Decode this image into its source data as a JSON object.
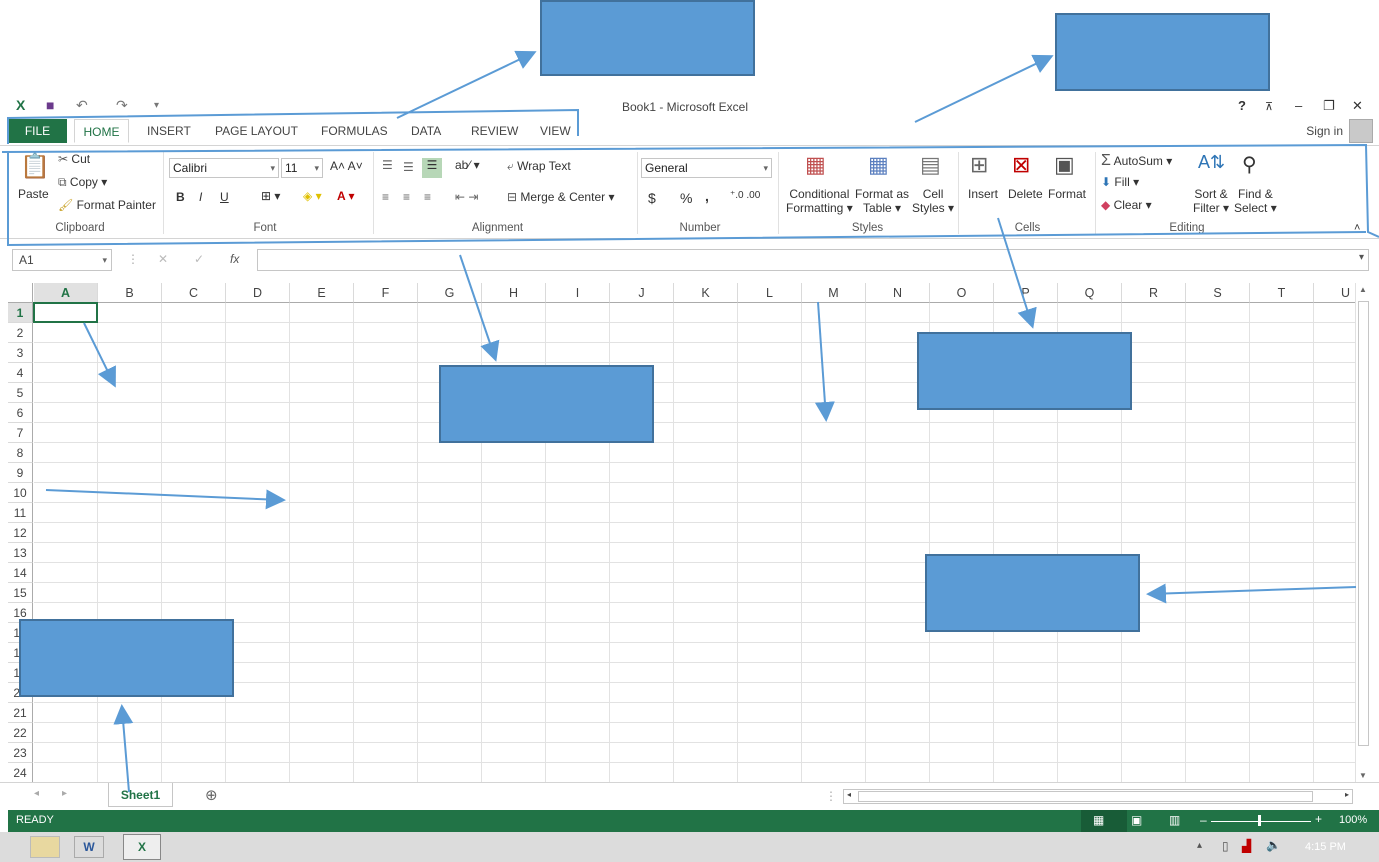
{
  "window": {
    "title": "Book1 - Microsoft Excel",
    "help": "?",
    "sign_in": "Sign in"
  },
  "tabs": [
    {
      "label": "FILE"
    },
    {
      "label": "HOME"
    },
    {
      "label": "INSERT"
    },
    {
      "label": "PAGE LAYOUT"
    },
    {
      "label": "FORMULAS"
    },
    {
      "label": "DATA"
    },
    {
      "label": "REVIEW"
    },
    {
      "label": "VIEW"
    }
  ],
  "ribbon": {
    "clipboard": {
      "paste": "Paste",
      "cut": "Cut",
      "copy": "Copy",
      "format_painter": "Format Painter",
      "label": "Clipboard"
    },
    "font": {
      "name": "Calibri",
      "size": "11",
      "bold": "B",
      "italic": "I",
      "underline": "U",
      "label": "Font"
    },
    "alignment": {
      "wrap_text": "Wrap Text",
      "merge_center": "Merge & Center",
      "label": "Alignment"
    },
    "number": {
      "format": "General",
      "currency": "$",
      "percent": "%",
      "comma": ",",
      "label": "Number"
    },
    "styles": {
      "conditional_1": "Conditional",
      "conditional_2": "Formatting",
      "format_table_1": "Format as",
      "format_table_2": "Table",
      "cell_styles_1": "Cell",
      "cell_styles_2": "Styles",
      "label": "Styles"
    },
    "cells": {
      "insert": "Insert",
      "delete": "Delete",
      "format": "Format",
      "label": "Cells"
    },
    "editing": {
      "autosum": "AutoSum",
      "fill": "Fill",
      "clear": "Clear",
      "sort_1": "Sort &",
      "sort_2": "Filter",
      "find_1": "Find &",
      "find_2": "Select",
      "label": "Editing"
    }
  },
  "formula_bar": {
    "name_box": "A1",
    "fx": "fx"
  },
  "sheet": {
    "columns": [
      "A",
      "B",
      "C",
      "D",
      "E",
      "F",
      "G",
      "H",
      "I",
      "J",
      "K",
      "L",
      "M",
      "N",
      "O",
      "P",
      "Q",
      "R",
      "S",
      "T",
      "U"
    ],
    "rows": [
      "1",
      "2",
      "3",
      "4",
      "5",
      "6",
      "7",
      "8",
      "9",
      "10",
      "11",
      "12",
      "13",
      "14",
      "15",
      "16",
      "17",
      "18",
      "19",
      "20",
      "21",
      "22",
      "23",
      "24"
    ],
    "tab": "Sheet1"
  },
  "status": {
    "ready": "READY",
    "zoom": "100%"
  },
  "taskbar": {
    "time": "4:15 PM"
  },
  "colors": {
    "excel_green": "#217346",
    "callout_box": "#5b9bd5",
    "callout_line": "#5b9bd5"
  }
}
